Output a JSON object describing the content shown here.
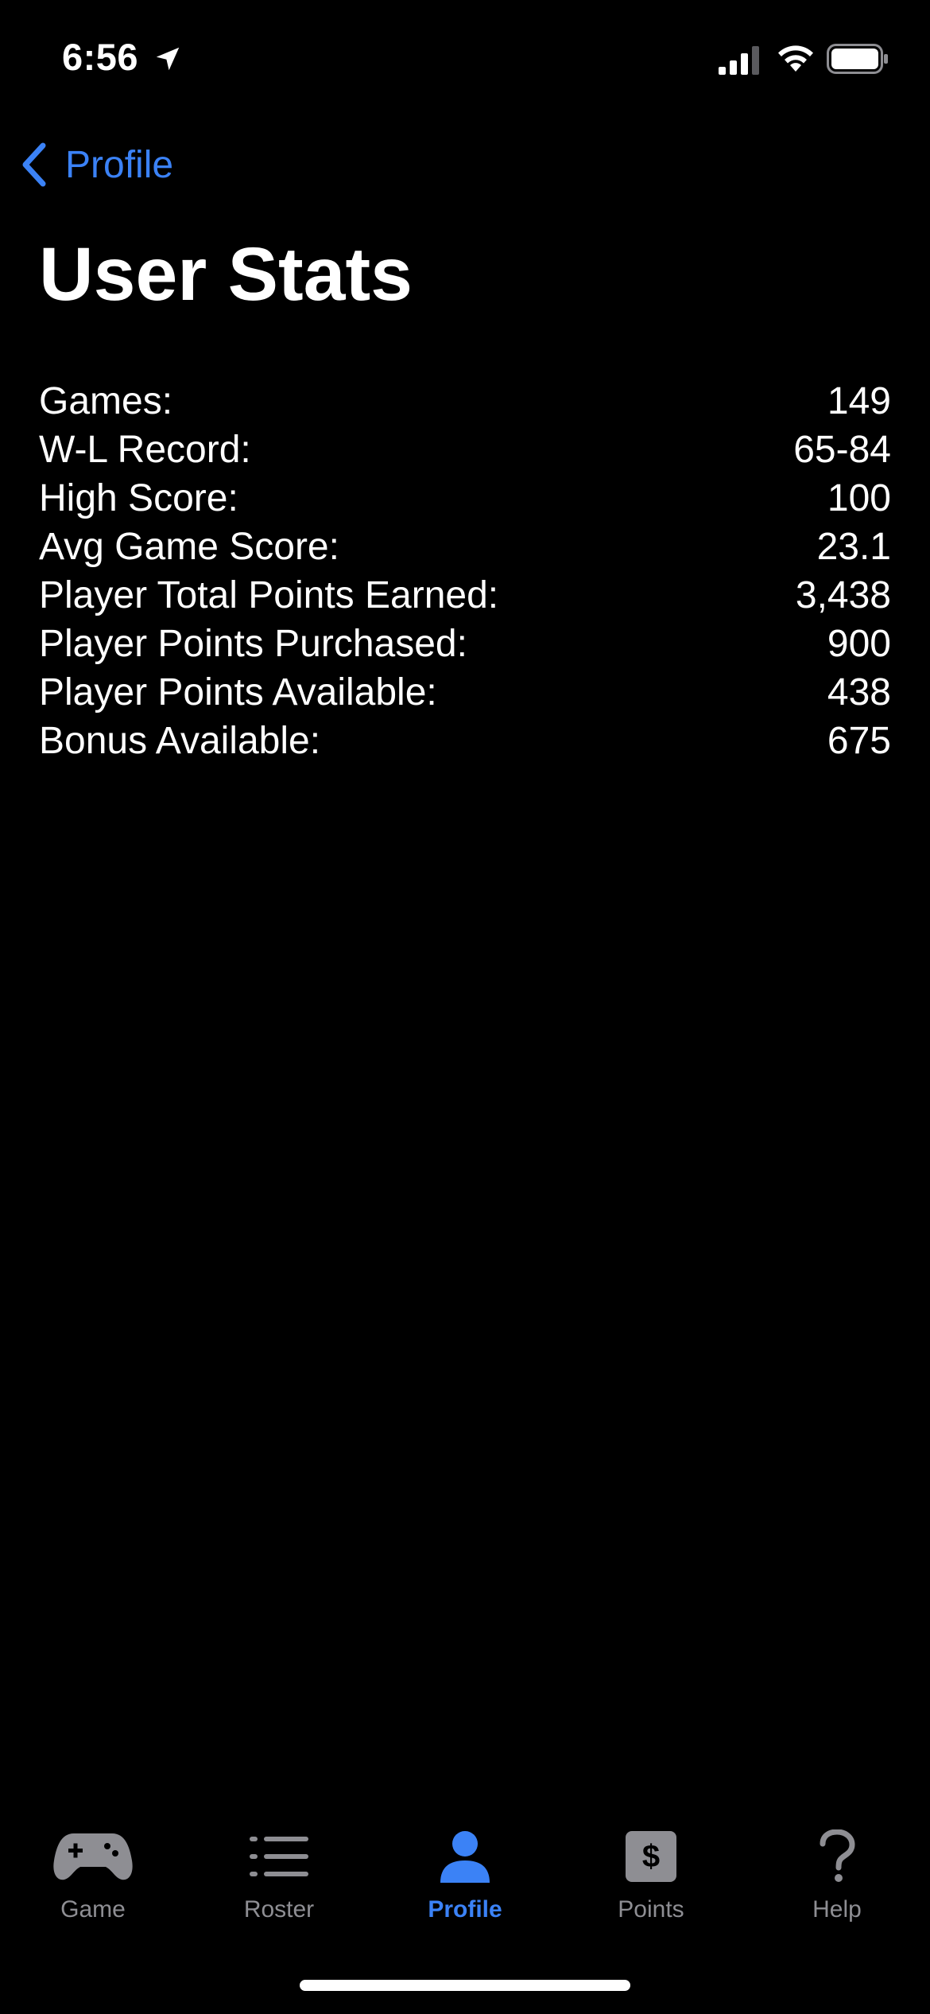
{
  "status_bar": {
    "time": "6:56"
  },
  "nav": {
    "back_label": "Profile"
  },
  "page": {
    "title": "User Stats"
  },
  "stats": [
    {
      "label": "Games:",
      "value": "149"
    },
    {
      "label": "W-L Record:",
      "value": "65-84"
    },
    {
      "label": "High Score:",
      "value": "100"
    },
    {
      "label": "Avg Game Score:",
      "value": "23.1"
    },
    {
      "label": "Player Total Points Earned:",
      "value": "3,438"
    },
    {
      "label": "Player Points Purchased:",
      "value": "900"
    },
    {
      "label": "Player Points Available:",
      "value": "438"
    },
    {
      "label": "Bonus Available:",
      "value": "675"
    }
  ],
  "tab_bar": {
    "tabs": [
      {
        "label": "Game",
        "icon": "gamecontroller-icon"
      },
      {
        "label": "Roster",
        "icon": "list-icon"
      },
      {
        "label": "Profile",
        "icon": "person-icon",
        "active": true
      },
      {
        "label": "Points",
        "icon": "dollar-icon"
      },
      {
        "label": "Help",
        "icon": "question-icon"
      }
    ]
  },
  "colors": {
    "accent": "#3b82f6",
    "inactive": "#8e8e93",
    "background": "#000000"
  }
}
